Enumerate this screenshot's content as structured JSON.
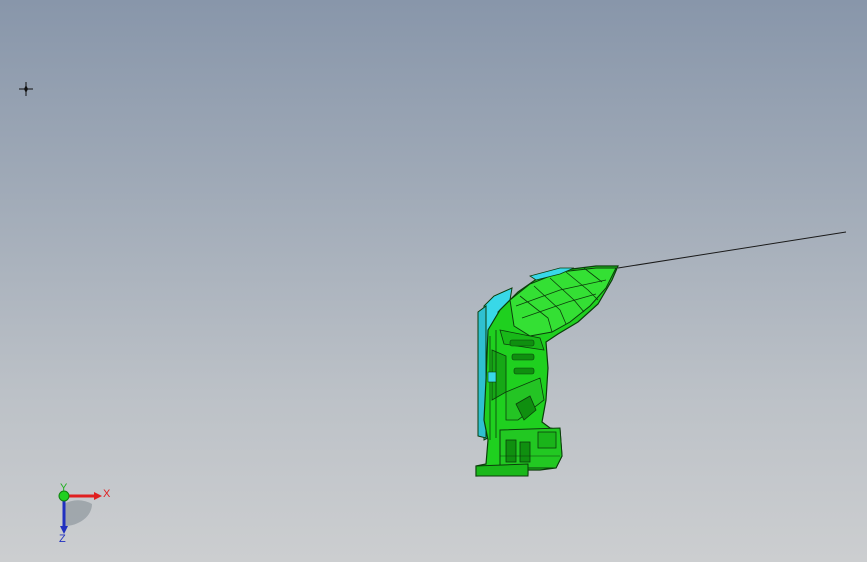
{
  "viewport": {
    "background_top": "#8896aa",
    "background_bottom": "#ccced0"
  },
  "origin_marker": {
    "icon": "crosshair-icon"
  },
  "model": {
    "body_color": "#1fd01f",
    "edge_color": "#0b3d0b",
    "accent_color": "#38d8e8",
    "sketch_line_color": "#1a1a1a"
  },
  "triad": {
    "x_label": "X",
    "y_label": "Y",
    "z_label": "Z",
    "x_color": "#e02020",
    "y_color": "#20b020",
    "z_color": "#2030c0"
  }
}
